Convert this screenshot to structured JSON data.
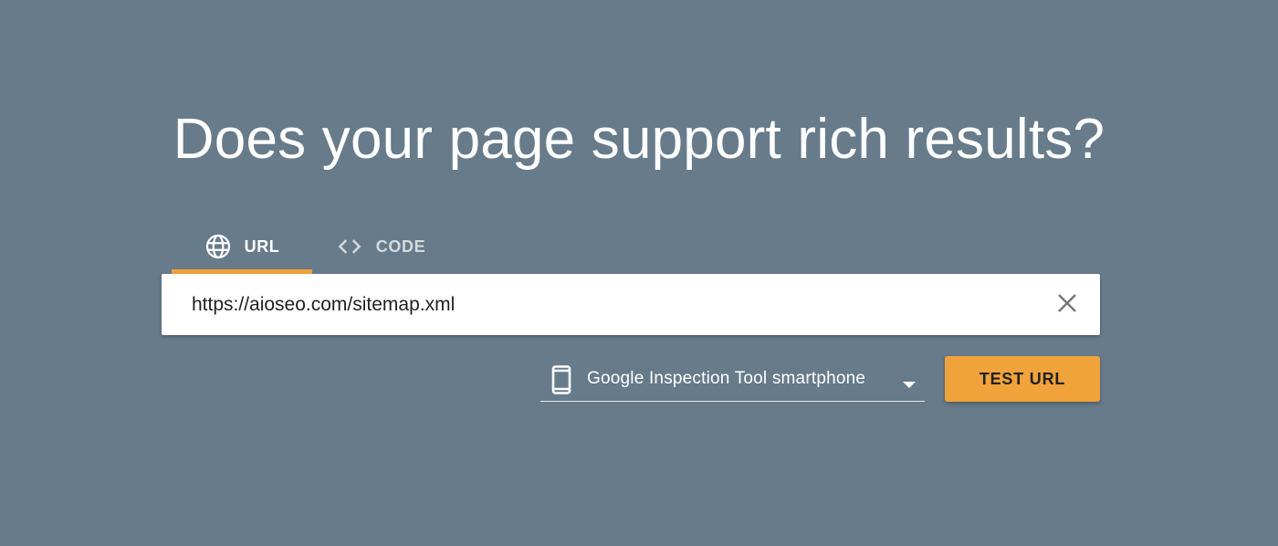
{
  "page": {
    "headline": "Does your page support rich results?"
  },
  "tabs": [
    {
      "label": "URL",
      "icon": "globe-icon",
      "active": true
    },
    {
      "label": "CODE",
      "icon": "code-icon",
      "active": false
    }
  ],
  "url_input": {
    "value": "https://aioseo.com/sitemap.xml",
    "clear_icon": "close-icon"
  },
  "user_agent": {
    "icon": "smartphone-icon",
    "selected": "Google Inspection Tool smartphone",
    "caret_icon": "caret-down-icon"
  },
  "test_button": {
    "label": "TEST URL"
  },
  "colors": {
    "background": "#677b8a",
    "accent": "#f0a23b",
    "text_light": "#ffffff",
    "input_background": "#ffffff",
    "input_text": "#212121"
  }
}
